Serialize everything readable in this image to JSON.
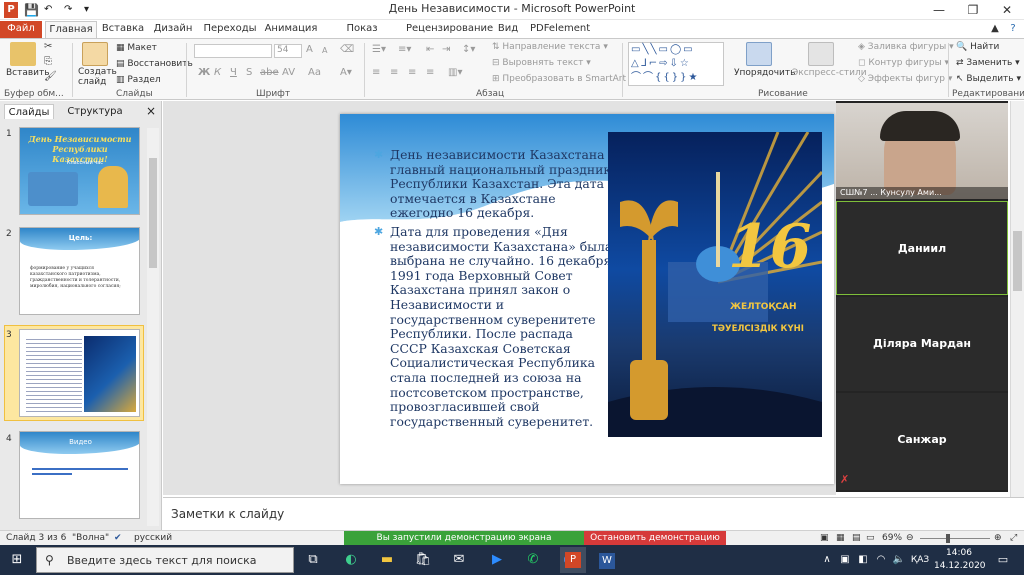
{
  "window": {
    "title": "День Независимости  -  Microsoft PowerPoint",
    "controls": [
      "—",
      "❐",
      "✕"
    ]
  },
  "ribbon": {
    "tabs": [
      {
        "label": "Файл",
        "active": false,
        "file": true
      },
      {
        "label": "Главная",
        "active": true
      },
      {
        "label": "Вставка"
      },
      {
        "label": "Дизайн"
      },
      {
        "label": "Переходы"
      },
      {
        "label": "Анимация"
      },
      {
        "label": "Показ слайдов"
      },
      {
        "label": "Рецензирование"
      },
      {
        "label": "Вид"
      },
      {
        "label": "PDFelement"
      }
    ],
    "clipboard": {
      "paste": "Вставить",
      "group": "Буфер обм..."
    },
    "slides": {
      "new_slide": "Создать слайд",
      "layout": "Макет",
      "reset": "Восстановить",
      "section": "Раздел",
      "group": "Слайды"
    },
    "font": {
      "size": "54",
      "group": "Шрифт",
      "bold": "Ж",
      "italic": "К",
      "underline": "Ч",
      "shadow": "S",
      "strike": "abe",
      "spacing": "AV",
      "case": "Aa",
      "grow": "A",
      "shrink": "A"
    },
    "paragraph": {
      "text_direction": "Направление текста",
      "align_text": "Выровнять текст",
      "smartart": "Преобразовать в SmartArt",
      "group": "Абзац"
    },
    "drawing": {
      "arrange": "Упорядочить",
      "quick_styles": "Экспресс-стили",
      "fill": "Заливка фигуры",
      "outline": "Контур фигуры",
      "effects": "Эффекты фигур",
      "group": "Рисование"
    },
    "editing": {
      "find": "Найти",
      "replace": "Заменить",
      "select": "Выделить",
      "group": "Редактирование"
    }
  },
  "left_panel": {
    "tabs": [
      "Слайды",
      "Структура"
    ],
    "close": "×",
    "slides": [
      {
        "num": "1",
        "title": "День Независимости Республики Казахстан!",
        "subtitle": "Классный час"
      },
      {
        "num": "2",
        "title": "Цель:",
        "body": "формирование у учащихся казахстанского патриотизма, гражданственности и толерантности, миролюбия, национального согласия;"
      },
      {
        "num": "3",
        "title": "",
        "selected": true
      },
      {
        "num": "4",
        "title": "Видео"
      }
    ]
  },
  "slide": {
    "paragraphs": [
      "День независимости Казахстана - главный национальный праздник Республики Казахстан.  Эта дата отмечается в Казахстане ежегодно 16 декабря.",
      "Дата для проведения «Дня независимости Казахстана» была выбрана не случайно. 16 декабря 1991 года Верховный Совет Казахстана принял закон о Независимости и государственном суверенитете Республики. После распада СССР Казахская Советская Социалистическая Республика стала последней из союза на постсоветском пространстве, провозгласившей свой государственный суверенитет."
    ],
    "image_text": {
      "number": "16",
      "line1": "ЖЕЛТОҚСАН",
      "line2": "ТӘУЕЛСІЗДІК КҮНІ"
    }
  },
  "notes": {
    "placeholder": "Заметки к слайду"
  },
  "meeting": {
    "participants": [
      {
        "name": "СШ№7  ...  Кунсулу Ами...",
        "video": true
      },
      {
        "name": "Даниил",
        "active": true
      },
      {
        "name": "Діляра Мардан"
      },
      {
        "name": "Санжар"
      }
    ]
  },
  "status": {
    "slide_info": "Слайд 3 из 6",
    "theme": "\"Волна\"",
    "language": "русский",
    "sharing": "Вы запустили демонстрацию экрана",
    "stop_sharing": "Остановить демонстрацию",
    "zoom": "69%"
  },
  "taskbar": {
    "search_placeholder": "Введите здесь текст для поиска",
    "language": "ҚАЗ",
    "time": "14:06",
    "date": "14.12.2020"
  },
  "colors": {
    "accent_ppt": "#d24726",
    "share_green": "#3aa23a",
    "stop_red": "#d63a3a",
    "slide_text": "#1f3864"
  }
}
